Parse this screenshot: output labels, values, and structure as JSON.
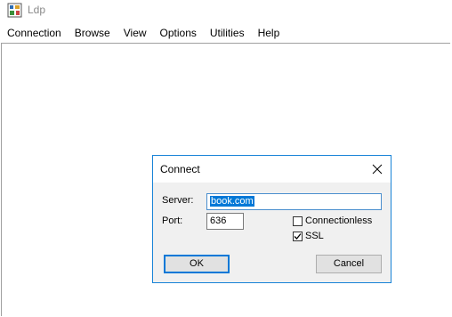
{
  "window": {
    "title": "Ldp",
    "icon": "ldp-app-icon"
  },
  "menu": [
    {
      "label": "Connection"
    },
    {
      "label": "Browse"
    },
    {
      "label": "View"
    },
    {
      "label": "Options"
    },
    {
      "label": "Utilities"
    },
    {
      "label": "Help"
    }
  ],
  "dialog": {
    "title": "Connect",
    "server_label": "Server:",
    "server_value": "book.com",
    "port_label": "Port:",
    "port_value": "636",
    "connectionless_label": "Connectionless",
    "connectionless_checked": false,
    "ssl_label": "SSL",
    "ssl_checked": true,
    "ok_label": "OK",
    "cancel_label": "Cancel",
    "accent_color": "#0078d7"
  }
}
